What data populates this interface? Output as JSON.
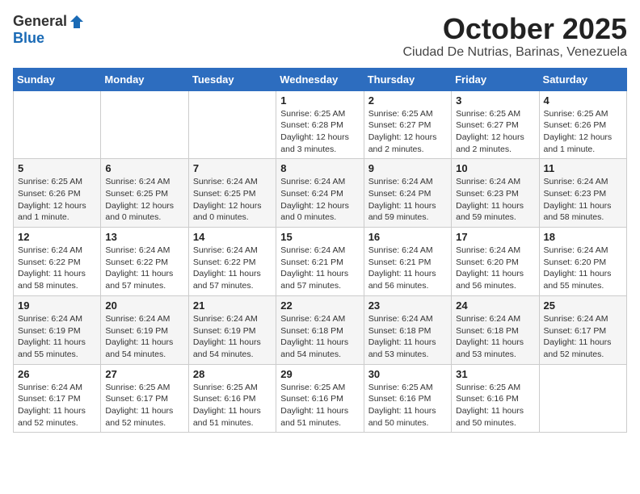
{
  "header": {
    "logo_general": "General",
    "logo_blue": "Blue",
    "month_title": "October 2025",
    "subtitle": "Ciudad De Nutrias, Barinas, Venezuela"
  },
  "days_of_week": [
    "Sunday",
    "Monday",
    "Tuesday",
    "Wednesday",
    "Thursday",
    "Friday",
    "Saturday"
  ],
  "weeks": [
    [
      {
        "day": "",
        "info": ""
      },
      {
        "day": "",
        "info": ""
      },
      {
        "day": "",
        "info": ""
      },
      {
        "day": "1",
        "info": "Sunrise: 6:25 AM\nSunset: 6:28 PM\nDaylight: 12 hours\nand 3 minutes."
      },
      {
        "day": "2",
        "info": "Sunrise: 6:25 AM\nSunset: 6:27 PM\nDaylight: 12 hours\nand 2 minutes."
      },
      {
        "day": "3",
        "info": "Sunrise: 6:25 AM\nSunset: 6:27 PM\nDaylight: 12 hours\nand 2 minutes."
      },
      {
        "day": "4",
        "info": "Sunrise: 6:25 AM\nSunset: 6:26 PM\nDaylight: 12 hours\nand 1 minute."
      }
    ],
    [
      {
        "day": "5",
        "info": "Sunrise: 6:25 AM\nSunset: 6:26 PM\nDaylight: 12 hours\nand 1 minute."
      },
      {
        "day": "6",
        "info": "Sunrise: 6:24 AM\nSunset: 6:25 PM\nDaylight: 12 hours\nand 0 minutes."
      },
      {
        "day": "7",
        "info": "Sunrise: 6:24 AM\nSunset: 6:25 PM\nDaylight: 12 hours\nand 0 minutes."
      },
      {
        "day": "8",
        "info": "Sunrise: 6:24 AM\nSunset: 6:24 PM\nDaylight: 12 hours\nand 0 minutes."
      },
      {
        "day": "9",
        "info": "Sunrise: 6:24 AM\nSunset: 6:24 PM\nDaylight: 11 hours\nand 59 minutes."
      },
      {
        "day": "10",
        "info": "Sunrise: 6:24 AM\nSunset: 6:23 PM\nDaylight: 11 hours\nand 59 minutes."
      },
      {
        "day": "11",
        "info": "Sunrise: 6:24 AM\nSunset: 6:23 PM\nDaylight: 11 hours\nand 58 minutes."
      }
    ],
    [
      {
        "day": "12",
        "info": "Sunrise: 6:24 AM\nSunset: 6:22 PM\nDaylight: 11 hours\nand 58 minutes."
      },
      {
        "day": "13",
        "info": "Sunrise: 6:24 AM\nSunset: 6:22 PM\nDaylight: 11 hours\nand 57 minutes."
      },
      {
        "day": "14",
        "info": "Sunrise: 6:24 AM\nSunset: 6:22 PM\nDaylight: 11 hours\nand 57 minutes."
      },
      {
        "day": "15",
        "info": "Sunrise: 6:24 AM\nSunset: 6:21 PM\nDaylight: 11 hours\nand 57 minutes."
      },
      {
        "day": "16",
        "info": "Sunrise: 6:24 AM\nSunset: 6:21 PM\nDaylight: 11 hours\nand 56 minutes."
      },
      {
        "day": "17",
        "info": "Sunrise: 6:24 AM\nSunset: 6:20 PM\nDaylight: 11 hours\nand 56 minutes."
      },
      {
        "day": "18",
        "info": "Sunrise: 6:24 AM\nSunset: 6:20 PM\nDaylight: 11 hours\nand 55 minutes."
      }
    ],
    [
      {
        "day": "19",
        "info": "Sunrise: 6:24 AM\nSunset: 6:19 PM\nDaylight: 11 hours\nand 55 minutes."
      },
      {
        "day": "20",
        "info": "Sunrise: 6:24 AM\nSunset: 6:19 PM\nDaylight: 11 hours\nand 54 minutes."
      },
      {
        "day": "21",
        "info": "Sunrise: 6:24 AM\nSunset: 6:19 PM\nDaylight: 11 hours\nand 54 minutes."
      },
      {
        "day": "22",
        "info": "Sunrise: 6:24 AM\nSunset: 6:18 PM\nDaylight: 11 hours\nand 54 minutes."
      },
      {
        "day": "23",
        "info": "Sunrise: 6:24 AM\nSunset: 6:18 PM\nDaylight: 11 hours\nand 53 minutes."
      },
      {
        "day": "24",
        "info": "Sunrise: 6:24 AM\nSunset: 6:18 PM\nDaylight: 11 hours\nand 53 minutes."
      },
      {
        "day": "25",
        "info": "Sunrise: 6:24 AM\nSunset: 6:17 PM\nDaylight: 11 hours\nand 52 minutes."
      }
    ],
    [
      {
        "day": "26",
        "info": "Sunrise: 6:24 AM\nSunset: 6:17 PM\nDaylight: 11 hours\nand 52 minutes."
      },
      {
        "day": "27",
        "info": "Sunrise: 6:25 AM\nSunset: 6:17 PM\nDaylight: 11 hours\nand 52 minutes."
      },
      {
        "day": "28",
        "info": "Sunrise: 6:25 AM\nSunset: 6:16 PM\nDaylight: 11 hours\nand 51 minutes."
      },
      {
        "day": "29",
        "info": "Sunrise: 6:25 AM\nSunset: 6:16 PM\nDaylight: 11 hours\nand 51 minutes."
      },
      {
        "day": "30",
        "info": "Sunrise: 6:25 AM\nSunset: 6:16 PM\nDaylight: 11 hours\nand 50 minutes."
      },
      {
        "day": "31",
        "info": "Sunrise: 6:25 AM\nSunset: 6:16 PM\nDaylight: 11 hours\nand 50 minutes."
      },
      {
        "day": "",
        "info": ""
      }
    ]
  ]
}
